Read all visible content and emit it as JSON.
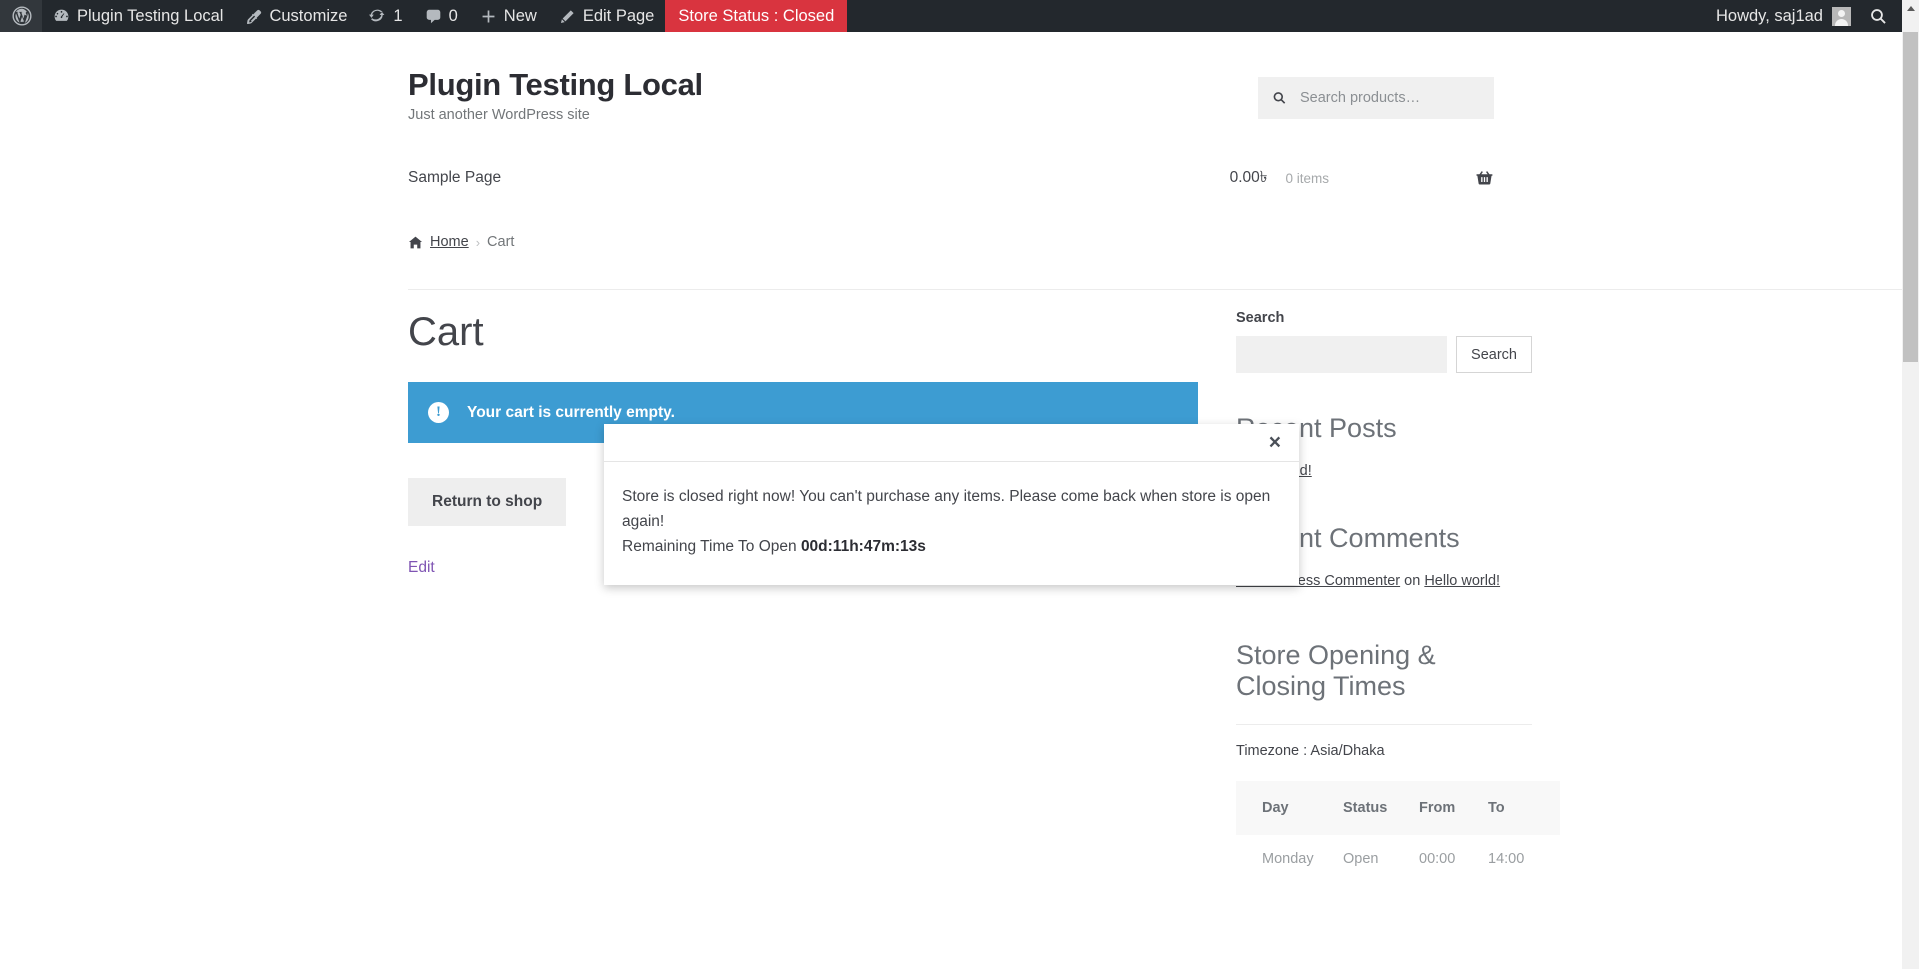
{
  "adminbar": {
    "wp_logo_name": "wordpress-logo-icon",
    "items": [
      {
        "label": "Plugin Testing Local",
        "icon": "dashboard-icon"
      },
      {
        "label": "Customize",
        "icon": "paintbrush-icon"
      },
      {
        "label": "1",
        "icon": "updates-icon"
      },
      {
        "label": "0",
        "icon": "comment-bubble-icon"
      },
      {
        "label": "New",
        "icon": "plus-icon"
      },
      {
        "label": "Edit Page",
        "icon": "pencil-icon"
      }
    ],
    "store_status": "Store Status : Closed",
    "store_status_color": "#d9343f",
    "howdy": "Howdy, saj1ad",
    "search_icon": "search-icon"
  },
  "header": {
    "site_title": "Plugin Testing Local",
    "site_description": "Just another WordPress site",
    "product_search": {
      "placeholder": "Search products…",
      "value": ""
    },
    "nav": [
      {
        "label": "Sample Page"
      }
    ],
    "cart": {
      "amount": "0.00৳",
      "items": "0 items",
      "icon": "basket-icon"
    }
  },
  "breadcrumb": {
    "home_icon": "home-icon",
    "home": "Home",
    "separator": "›",
    "current": "Cart"
  },
  "main": {
    "page_title": "Cart",
    "notice": {
      "icon": "info-circle-icon",
      "text": "Your cart is currently empty.",
      "color": "#3d9cd2"
    },
    "return_button": "Return to shop",
    "edit_link": "Edit",
    "edit_link_color": "#7f54b3"
  },
  "modal": {
    "close_label": "×",
    "message": "Store is closed right now! You can't purchase any items. Please come back when store is open again!",
    "countdown_label": "Remaining Time To Open",
    "countdown_value": "00d:11h:47m:13s"
  },
  "sidebar": {
    "search_widget": {
      "title": "Search",
      "input_value": "",
      "input_placeholder": "",
      "button_label": "Search"
    },
    "recent_posts": {
      "title": "Recent Posts",
      "items": [
        {
          "label": "Hello world!"
        }
      ]
    },
    "recent_comments": {
      "title": "Recent Comments",
      "items": [
        {
          "author": "A WordPress Commenter",
          "connector": "on",
          "post": "Hello world!"
        }
      ]
    },
    "store_hours": {
      "title": "Store Opening & Closing Times",
      "timezone": "Timezone : Asia/Dhaka",
      "columns": [
        "Day",
        "Status",
        "From",
        "To"
      ],
      "rows": [
        {
          "day": "Monday",
          "status": "Open",
          "from": "00:00",
          "to": "14:00"
        }
      ]
    }
  },
  "scrollbar": {
    "up_arrow": "scroll-up-arrow-icon"
  }
}
